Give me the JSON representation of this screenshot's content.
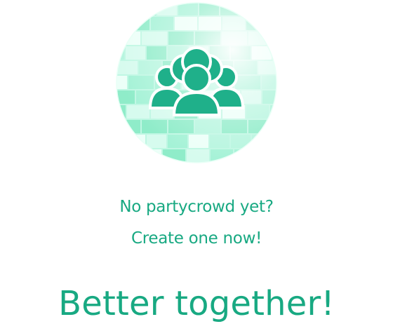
{
  "empty_state": {
    "illustration_icon": "group-people-icon",
    "line1": "No partycrowd yet?",
    "line2": "Create one now!",
    "tagline": "Better together!"
  },
  "colors": {
    "accent": "#1fb08a",
    "disco_light": "#d6fbee",
    "disco_mid": "#a4f2d6",
    "text": "#18a982"
  }
}
